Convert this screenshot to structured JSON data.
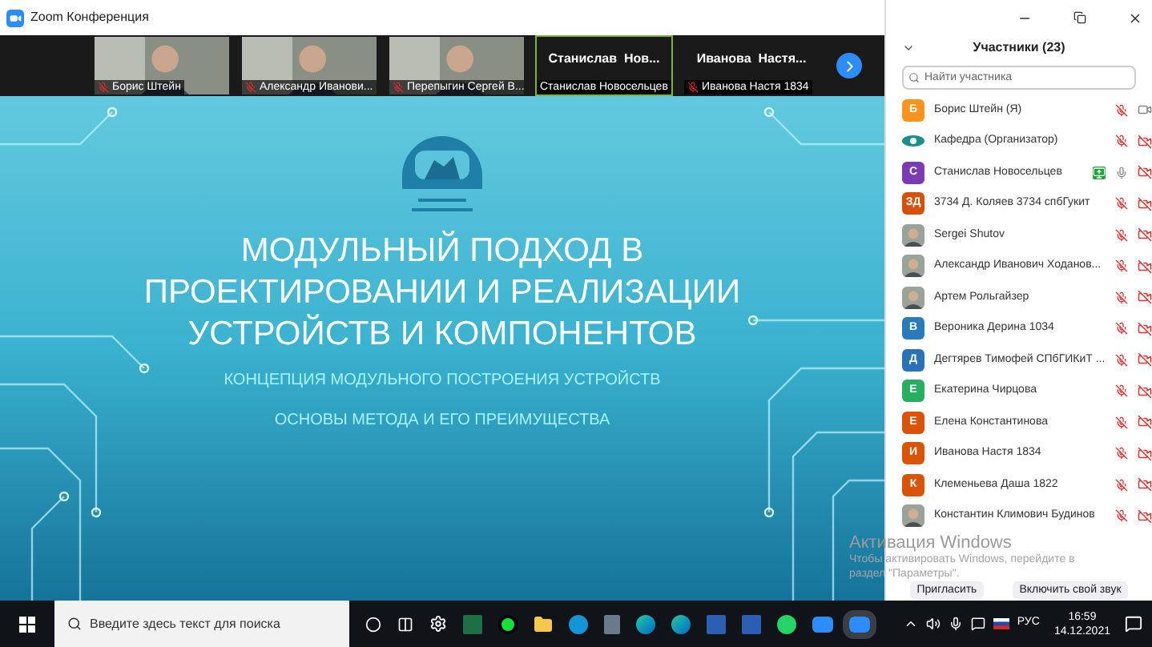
{
  "window": {
    "title": "Zoom Конференция"
  },
  "video_strip": {
    "tiles": [
      {
        "kind": "video",
        "label": "Борис Штейн",
        "mic_muted": true,
        "speaking": false
      },
      {
        "kind": "video",
        "label": "Александр Иванови...",
        "mic_muted": true,
        "speaking": false
      },
      {
        "kind": "video",
        "label": "Перепыгин Сергей В...",
        "mic_muted": true,
        "speaking": false
      },
      {
        "kind": "name",
        "name": "Станислав  Нов...",
        "label": "Станислав Новосельцев",
        "mic_muted": false,
        "speaking": true
      },
      {
        "kind": "name",
        "name": "Иванова  Настя...",
        "label": "Иванова Настя 1834",
        "mic_muted": true,
        "speaking": false
      }
    ]
  },
  "slide": {
    "title": [
      "МОДУЛЬНЫЙ ПОДХОД В",
      "ПРОЕКТИРОВАНИИ И РЕАЛИЗАЦИИ",
      "УСТРОЙСТВ И КОМПОНЕНТОВ"
    ],
    "subtitles": [
      "КОНЦЕПЦИЯ МОДУЛЬНОГО ПОСТРОЕНИЯ УСТРОЙСТВ",
      "ОСНОВЫ МЕТОДА И ЕГО ПРЕИМУЩЕСТВА"
    ]
  },
  "participants": {
    "title": "Участники (23)",
    "search": {
      "placeholder": "Найти участника"
    },
    "items": [
      {
        "name": "Борис Штейн (Я)",
        "avatar": {
          "kind": "letter",
          "letter": "Б",
          "color": "#f7931e"
        },
        "sharing": false,
        "mic_muted": true,
        "video_off": false
      },
      {
        "name": "Кафедра (Организатор)",
        "avatar": {
          "kind": "logo"
        },
        "sharing": false,
        "mic_muted": true,
        "video_off": true
      },
      {
        "name": "Станислав Новосельцев",
        "avatar": {
          "kind": "letter",
          "letter": "С",
          "color": "#7b3bb3"
        },
        "sharing": true,
        "mic_muted": false,
        "video_off": true
      },
      {
        "name": "3734 Д. Коляев 3734 спбГукит",
        "avatar": {
          "kind": "letter",
          "letter": "ЗД",
          "color": "#d4510a"
        },
        "sharing": false,
        "mic_muted": true,
        "video_off": true
      },
      {
        "name": "Sergei Shutov",
        "sharing": false,
        "mic_muted": true,
        "video_off": true
      },
      {
        "name": "Александр Иванович Ходанов...",
        "sharing": false,
        "mic_muted": true,
        "video_off": true
      },
      {
        "name": "Артем Рольгайзер",
        "sharing": false,
        "mic_muted": true,
        "video_off": true
      },
      {
        "name": "Вероника Дерина 1034",
        "avatar": {
          "kind": "letter",
          "letter": "В",
          "color": "#2b7bbb"
        },
        "sharing": false,
        "mic_muted": true,
        "video_off": true
      },
      {
        "name": "Дегтярев Тимофей СПбГИКиТ ...",
        "avatar": {
          "kind": "letter",
          "letter": "Д",
          "color": "#2a72b5"
        },
        "sharing": false,
        "mic_muted": true,
        "video_off": true
      },
      {
        "name": "Екатерина Чирцова",
        "avatar": {
          "kind": "letter",
          "letter": "Е",
          "color": "#27ae60"
        },
        "sharing": false,
        "mic_muted": true,
        "video_off": true
      },
      {
        "name": "Елена Константинова",
        "avatar": {
          "kind": "letter",
          "letter": "Е",
          "color": "#d9530b"
        },
        "sharing": false,
        "mic_muted": true,
        "video_off": true
      },
      {
        "name": "Иванова Настя 1834",
        "avatar": {
          "kind": "letter",
          "letter": "И",
          "color": "#d9530b"
        },
        "sharing": false,
        "mic_muted": true,
        "video_off": true
      },
      {
        "name": "Клеменьева Даша 1822",
        "avatar": {
          "kind": "letter",
          "letter": "К",
          "color": "#d9530b"
        },
        "sharing": false,
        "mic_muted": true,
        "video_off": true
      },
      {
        "name": "Константин Климович Будинов",
        "sharing": false,
        "mic_muted": true,
        "video_off": true
      }
    ],
    "buttons": [
      "Пригласить",
      "Включить свой звук"
    ]
  },
  "activation": {
    "title": "Активация Windows",
    "text": [
      "Чтобы активировать Windows, перейдите в",
      "раздел \"Параметры\"."
    ]
  },
  "taskbar": {
    "search": {
      "placeholder": "Введите здесь текст для поиска"
    },
    "language": "РУС",
    "time": "16:59",
    "date": "14.12.2021"
  }
}
